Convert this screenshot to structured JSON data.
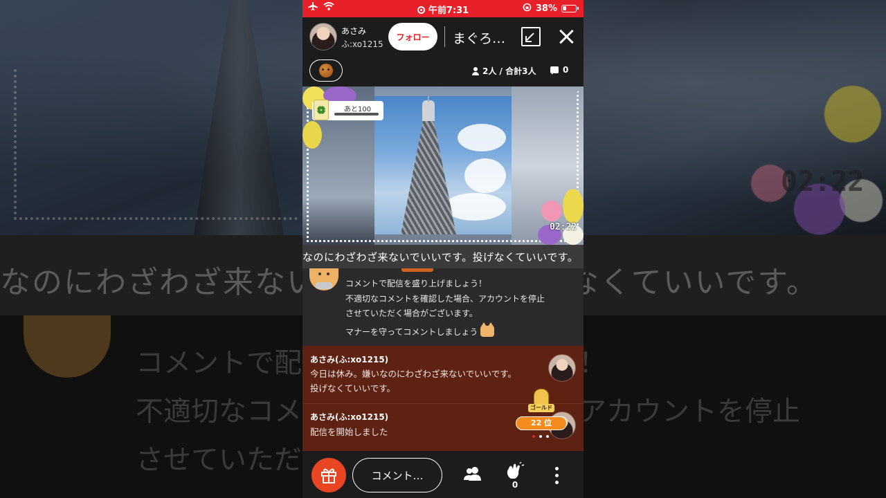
{
  "status_bar": {
    "time": "午前7:31",
    "battery": "38%"
  },
  "header": {
    "host_name": "あさみ",
    "host_id": "ふ:xo1215",
    "follow_label": "フォロー",
    "room_title": "まぐろ…"
  },
  "info": {
    "viewers": "2人 / 合計3人",
    "comment_count": "0"
  },
  "video": {
    "goal_label": "あと100",
    "timer": "02:22"
  },
  "ticker": {
    "text": "なのにわざわざ来ないでいいです。投げなくていいです。"
  },
  "backdrop": {
    "timer": "02:22",
    "band_text": "なのにわざわざ来ないでいいです。投げなくていいです。",
    "lower_line_1": "コメントで配信を盛り上げましょう！",
    "lower_line_2": "不適切なコメントを確認した場合、アカウントを停止",
    "lower_line_3": "させていただく場合がございます。"
  },
  "notice": {
    "line1": "コメントで配信を盛り上げましょう！",
    "line2": "不適切なコメントを確認した場合、アカウントを停止",
    "line3": "させていただく場合がございます。",
    "line4": "マナーを守ってコメントしましょう"
  },
  "comments": [
    {
      "user": "あさみ(ふ:xo1215)",
      "line1": "今日は休み。嫌いなのにわざわざ来ないでいいです。",
      "line2": "投げなくていいです。"
    },
    {
      "user": "あさみ(ふ:xo1215)",
      "line1": "配信を開始しました",
      "line2": ""
    }
  ],
  "ranking": {
    "badge_label": "ゴールド",
    "rank": "22 位"
  },
  "bottom_bar": {
    "comment_placeholder": "コメント…",
    "clap_count": "0"
  },
  "colors": {
    "accent_red": "#e8202a",
    "gift_orange": "#e84622",
    "rank_orange": "#f58b1c",
    "comment_bg": "#5e2213"
  }
}
